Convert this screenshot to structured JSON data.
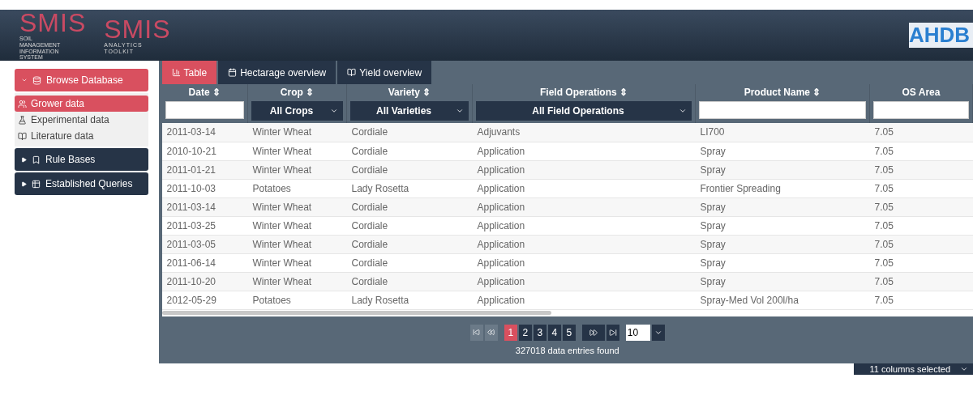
{
  "header": {
    "logo_left": {
      "title": "SMIS",
      "subtitle": "SOIL MANAGEMENT INFORMATION SYSTEM"
    },
    "logo_middle": {
      "title": "SMIS",
      "subtitle": "ANALYTICS TOOLKIT"
    },
    "logo_right": {
      "title": "AHDB"
    }
  },
  "sidebar": {
    "sections": [
      {
        "label": "Browse Database",
        "expanded": true,
        "selected": true,
        "children": [
          {
            "label": "Grower data",
            "selected": true
          },
          {
            "label": "Experimental data",
            "selected": false
          },
          {
            "label": "Literature data",
            "selected": false
          }
        ]
      },
      {
        "label": "Rule Bases",
        "expanded": false,
        "selected": false
      },
      {
        "label": "Established Queries",
        "expanded": false,
        "selected": false
      }
    ]
  },
  "tabs": [
    {
      "label": "Table",
      "selected": true
    },
    {
      "label": "Hectarage overview",
      "selected": false
    },
    {
      "label": "Yield overview",
      "selected": false
    }
  ],
  "table": {
    "columns": [
      {
        "label": "Date ⇕",
        "filter": {
          "kind": "text"
        }
      },
      {
        "label": "Crop ⇕",
        "filter": {
          "kind": "select",
          "value": "All Crops"
        }
      },
      {
        "label": "Variety ⇕",
        "filter": {
          "kind": "select",
          "value": "All Varieties"
        }
      },
      {
        "label": "Field Operations ⇕",
        "filter": {
          "kind": "select",
          "value": "All Field Operations"
        }
      },
      {
        "label": "Product Name ⇕",
        "filter": {
          "kind": "text"
        }
      },
      {
        "label": "OS Area",
        "filter": {
          "kind": "text"
        }
      }
    ],
    "rows": [
      [
        "2011-03-14",
        "Winter Wheat",
        "Cordiale",
        "Adjuvants",
        "LI700",
        "7.05"
      ],
      [
        "2010-10-21",
        "Winter Wheat",
        "Cordiale",
        "Application",
        "Spray",
        "7.05"
      ],
      [
        "2011-01-21",
        "Winter Wheat",
        "Cordiale",
        "Application",
        "Spray",
        "7.05"
      ],
      [
        "2011-10-03",
        "Potatoes",
        "Lady Rosetta",
        "Application",
        "Frontier Spreading",
        "7.05"
      ],
      [
        "2011-03-14",
        "Winter Wheat",
        "Cordiale",
        "Application",
        "Spray",
        "7.05"
      ],
      [
        "2011-03-25",
        "Winter Wheat",
        "Cordiale",
        "Application",
        "Spray",
        "7.05"
      ],
      [
        "2011-03-05",
        "Winter Wheat",
        "Cordiale",
        "Application",
        "Spray",
        "7.05"
      ],
      [
        "2011-06-14",
        "Winter Wheat",
        "Cordiale",
        "Application",
        "Spray",
        "7.05"
      ],
      [
        "2011-10-20",
        "Winter Wheat",
        "Cordiale",
        "Application",
        "Spray",
        "7.05"
      ],
      [
        "2012-05-29",
        "Potatoes",
        "Lady Rosetta",
        "Application",
        "Spray-Med Vol 200l/ha",
        "7.05"
      ]
    ]
  },
  "pager": {
    "pages": [
      {
        "label": "1",
        "selected": true
      },
      {
        "label": "2",
        "selected": false
      },
      {
        "label": "3",
        "selected": false
      },
      {
        "label": "4",
        "selected": false
      },
      {
        "label": "5",
        "selected": false
      }
    ],
    "page_size": "10",
    "summary": "327018 data entries found"
  },
  "columns_button": "11 columns selected"
}
